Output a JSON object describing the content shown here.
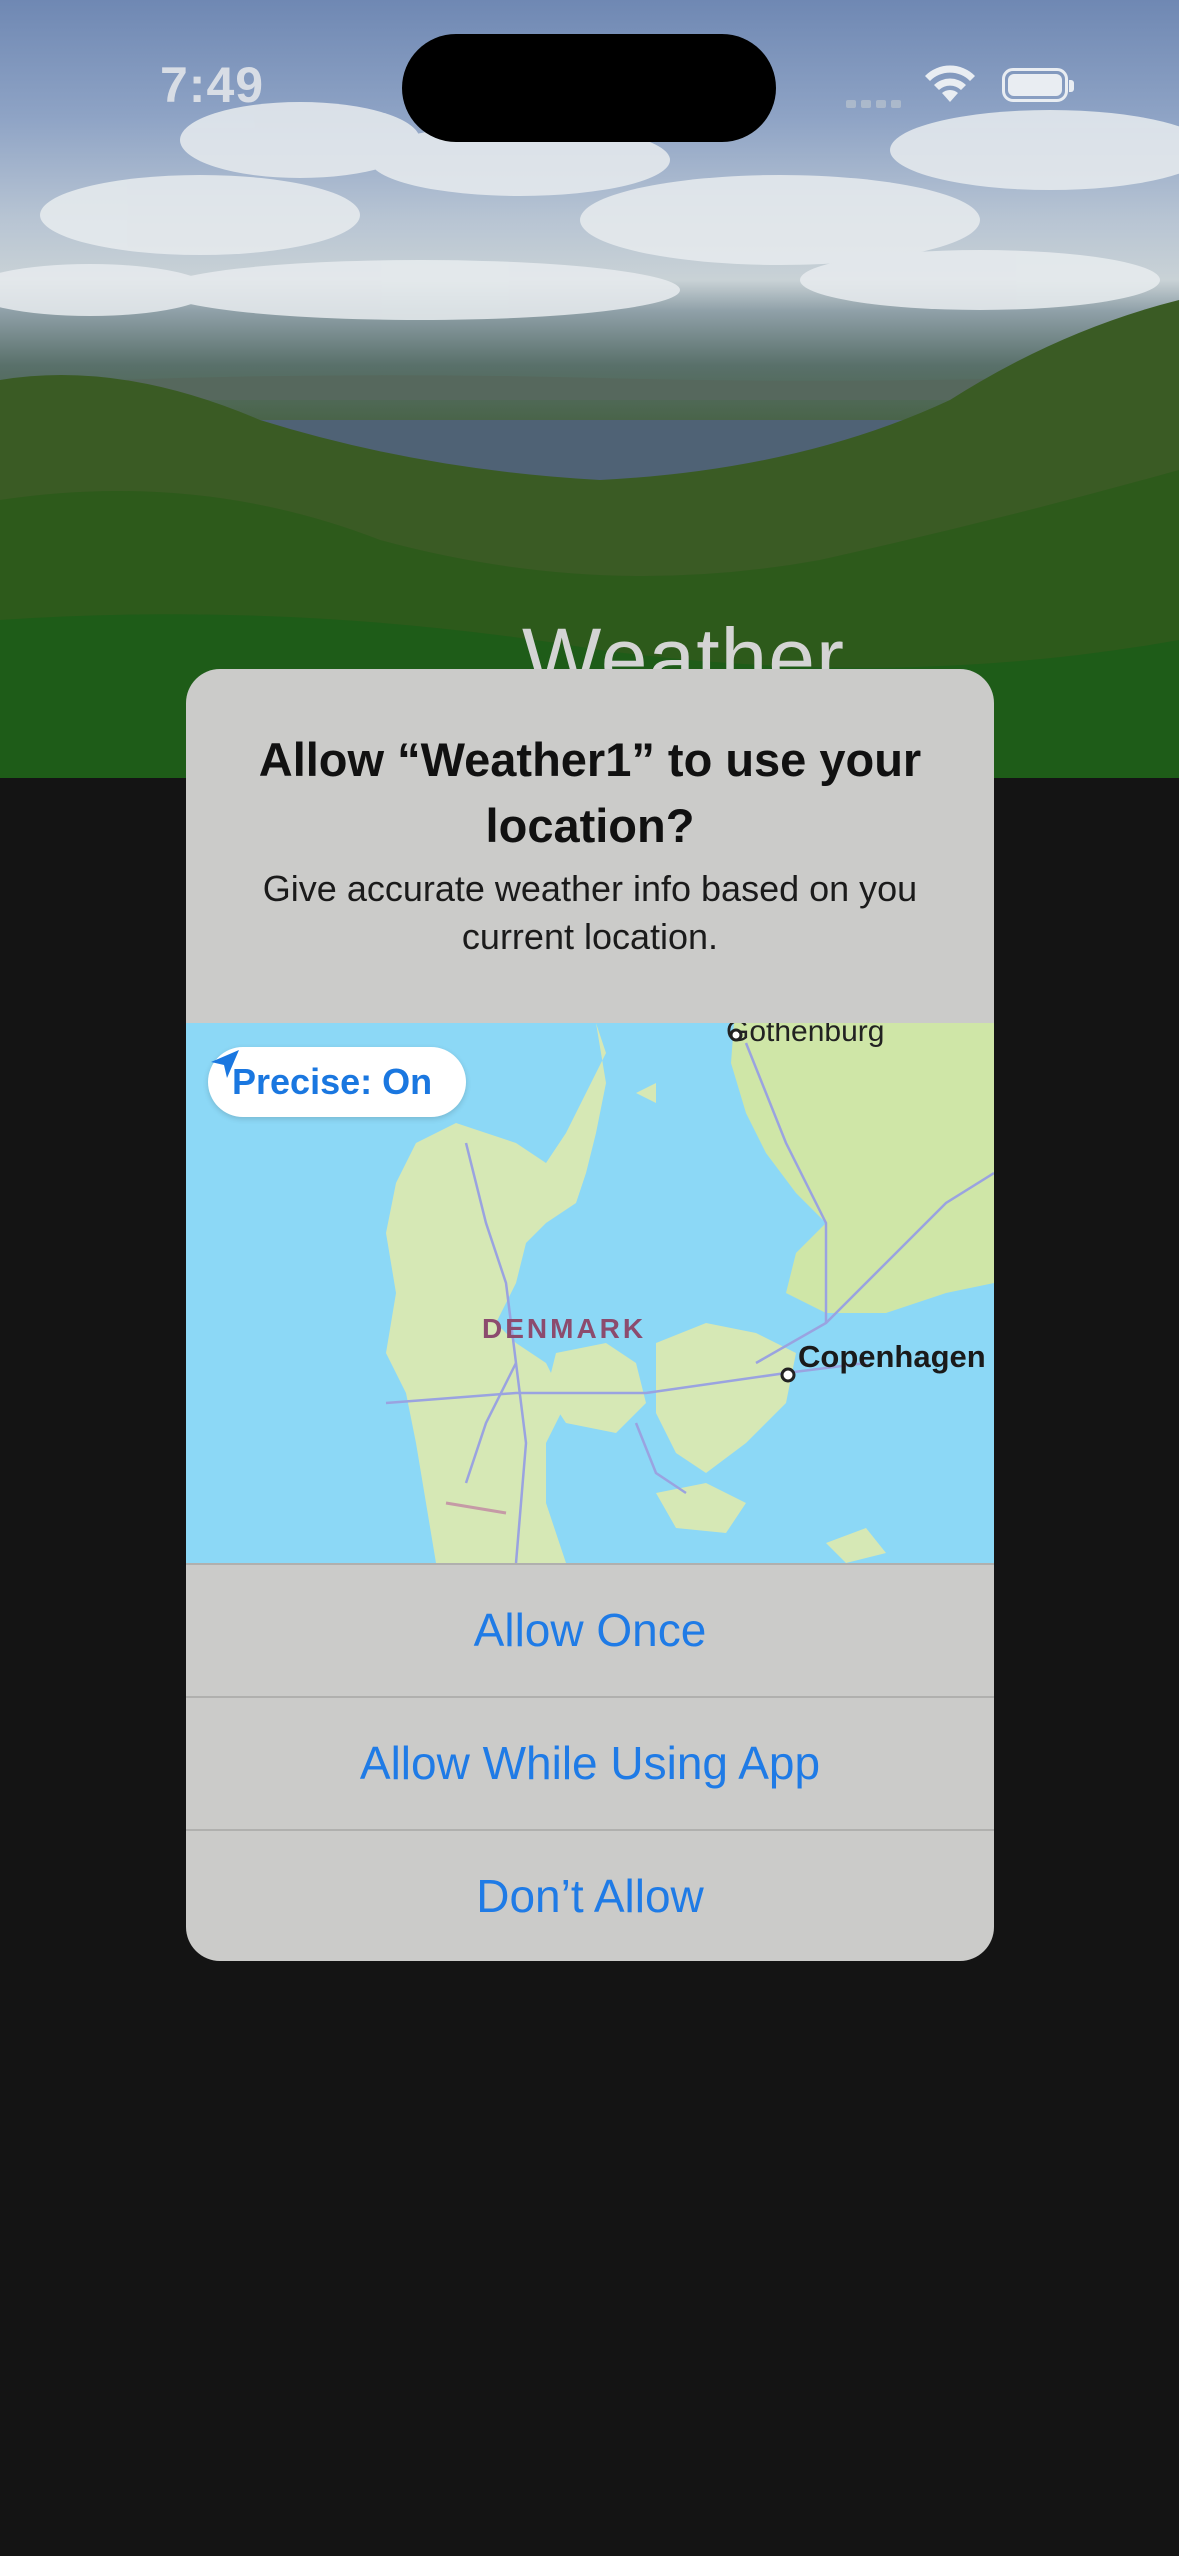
{
  "status_bar": {
    "time": "7:49"
  },
  "background": {
    "title": "Weather"
  },
  "alert": {
    "title": "Allow “Weather1” to use your location?",
    "message": "Give accurate weather info based on you current location.",
    "precise_toggle": {
      "label": "Precise: On",
      "icon": "location-arrow-icon"
    },
    "map": {
      "labels": {
        "country": "DENMARK",
        "city1": "Gothenburg",
        "city2": "Copenhagen"
      }
    },
    "buttons": {
      "allow_once": "Allow Once",
      "allow_while_using": "Allow While Using App",
      "dont_allow": "Don’t Allow"
    }
  },
  "colors": {
    "accent": "#1f7be6",
    "alert_bg": "#cbcbc9",
    "page_bg": "#141414",
    "map_water": "#8cd8f6",
    "map_land": "#d6e8b5"
  }
}
